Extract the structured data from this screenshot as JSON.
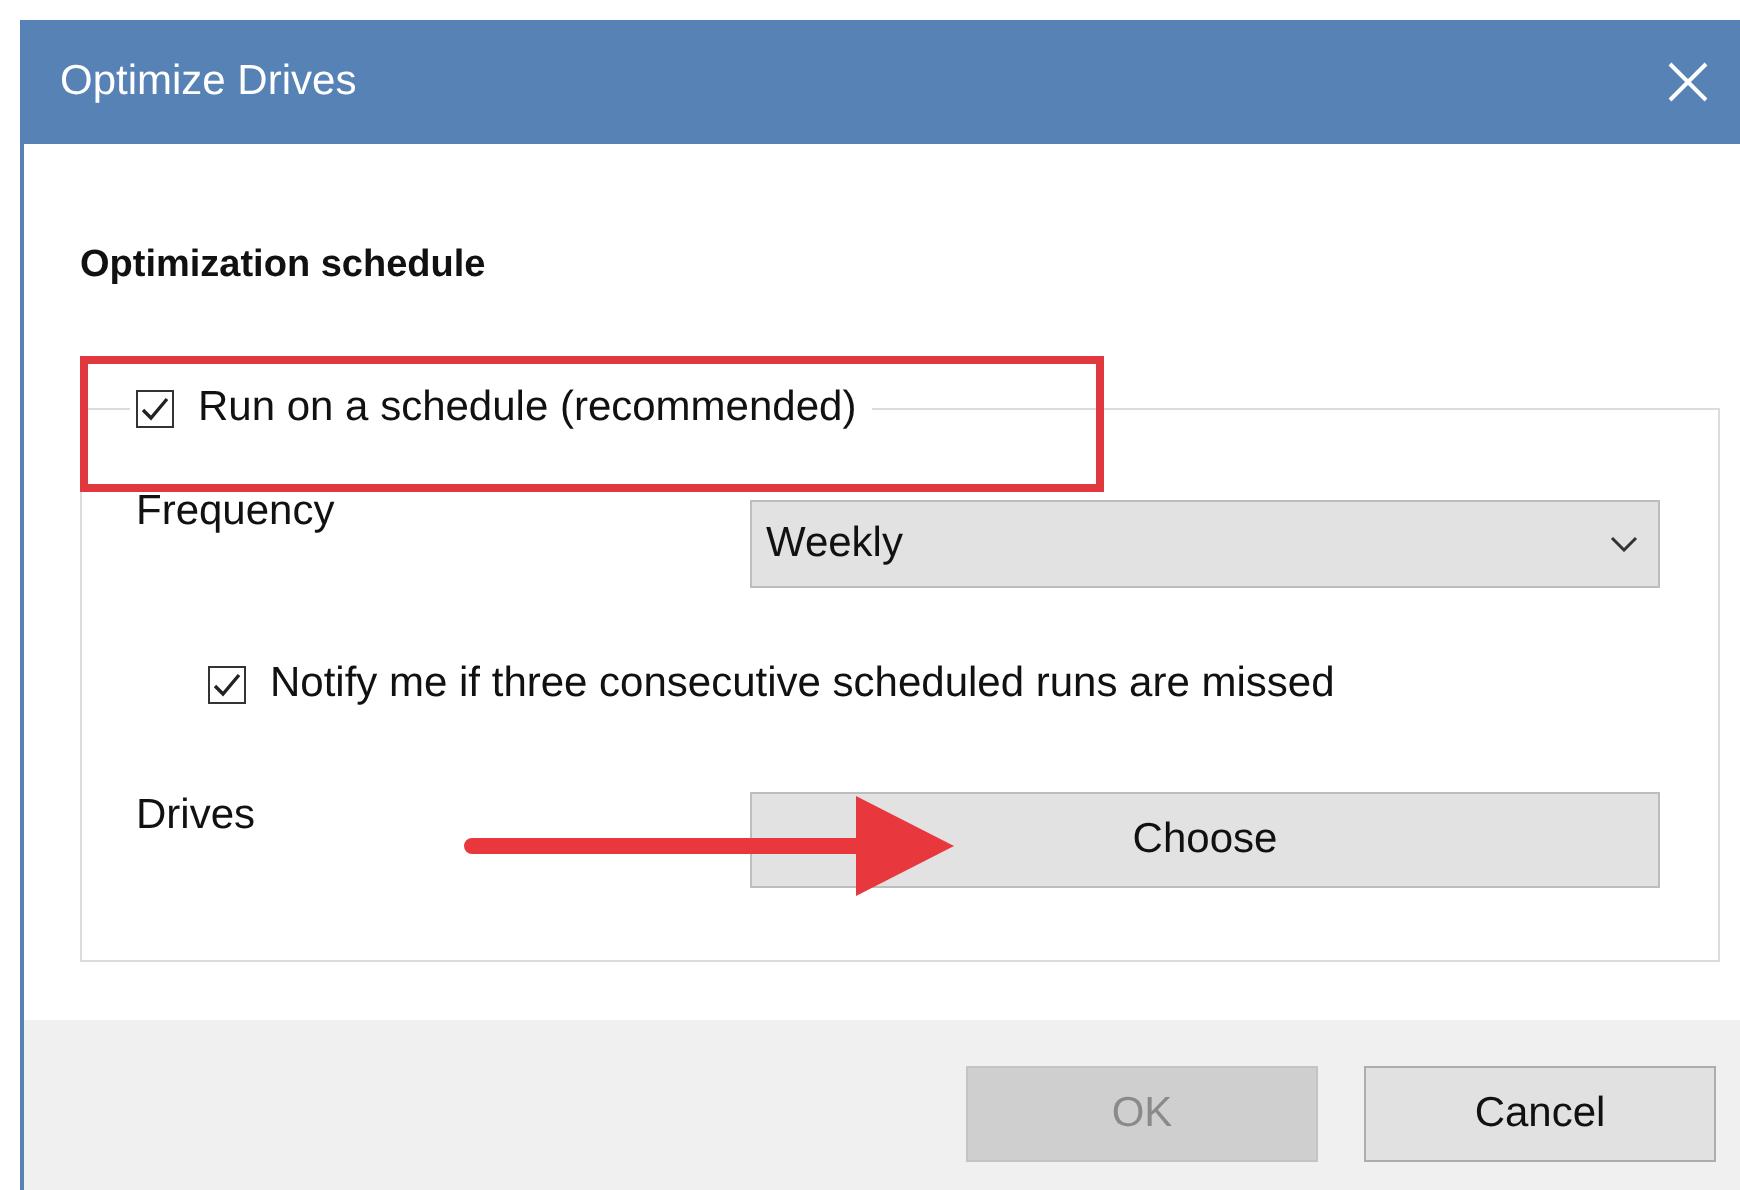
{
  "window": {
    "title": "Optimize Drives"
  },
  "section_title": "Optimization schedule",
  "schedule": {
    "label": "Run on a schedule (recommended)",
    "checked": true,
    "highlighted": true
  },
  "frequency": {
    "label": "Frequency",
    "value": "Weekly"
  },
  "notify": {
    "label": "Notify me if three consecutive scheduled runs are missed",
    "checked": true
  },
  "drives": {
    "label": "Drives",
    "button": "Choose",
    "arrow": true
  },
  "buttons": [
    {
      "label": "OK",
      "disabled": true
    },
    {
      "label": "Cancel",
      "disabled": false
    }
  ]
}
